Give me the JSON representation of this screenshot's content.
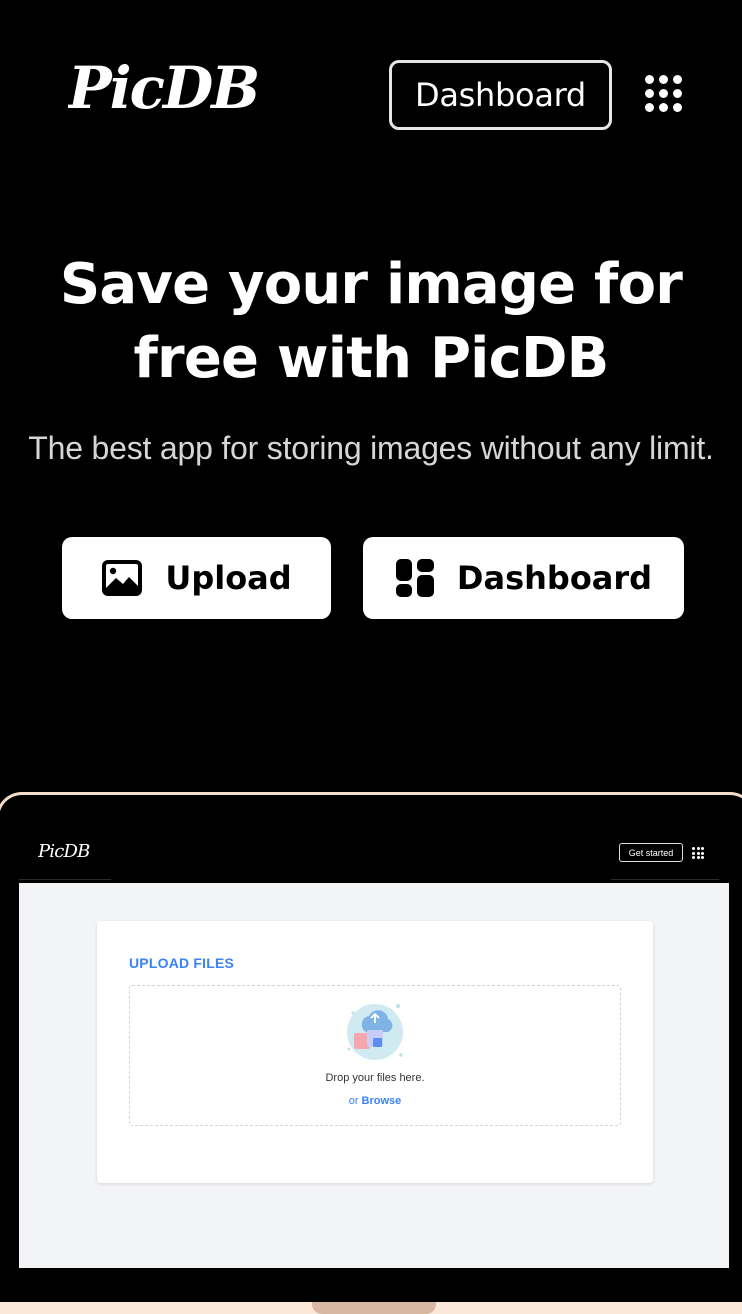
{
  "header": {
    "logo_text": "PicDB",
    "dashboard_label": "Dashboard",
    "apps_icon": "grid-dots-icon"
  },
  "hero": {
    "title_line1": "Save your image for",
    "title_line2": "free with PicDB",
    "subtitle": "The best app for storing images without any limit.",
    "upload_label": "Upload",
    "upload_icon": "image-icon",
    "dashboard_label": "Dashboard",
    "dashboard_icon": "dashboard-icon"
  },
  "mockup": {
    "logo_text": "PicDB",
    "get_started_label": "Get started",
    "upload_title": "UPLOAD FILES",
    "drop_text": "Drop your files here.",
    "or_text": "or",
    "browse_label": "Browse"
  },
  "colors": {
    "background": "#000000",
    "accent_blue": "#3b82f6",
    "laptop_frame": "#f2dccb"
  }
}
